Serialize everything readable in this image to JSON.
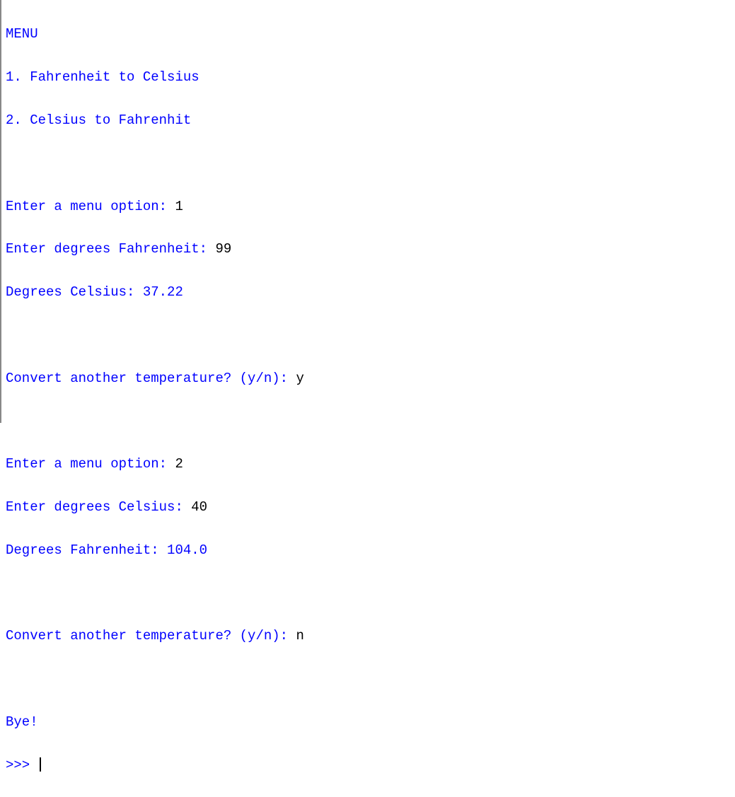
{
  "lines": {
    "menu_title": "MENU",
    "menu_option1": "1. Fahrenheit to Celsius",
    "menu_option2": "2. Celsius to Fahrenhit",
    "blank": " ",
    "prompt_menu1": "Enter a menu option: ",
    "input_menu1": "1",
    "prompt_fahrenheit": "Enter degrees Fahrenheit: ",
    "input_fahrenheit": "99",
    "result_celsius": "Degrees Celsius: 37.22",
    "prompt_convert1": "Convert another temperature? (y/n): ",
    "input_convert1": "y",
    "prompt_menu2": "Enter a menu option: ",
    "input_menu2": "2",
    "prompt_celsius": "Enter degrees Celsius: ",
    "input_celsius": "40",
    "result_fahrenheit": "Degrees Fahrenheit: 104.0",
    "prompt_convert2": "Convert another temperature? (y/n): ",
    "input_convert2": "n",
    "bye": "Bye!",
    "repl_prompt": ">>> "
  }
}
